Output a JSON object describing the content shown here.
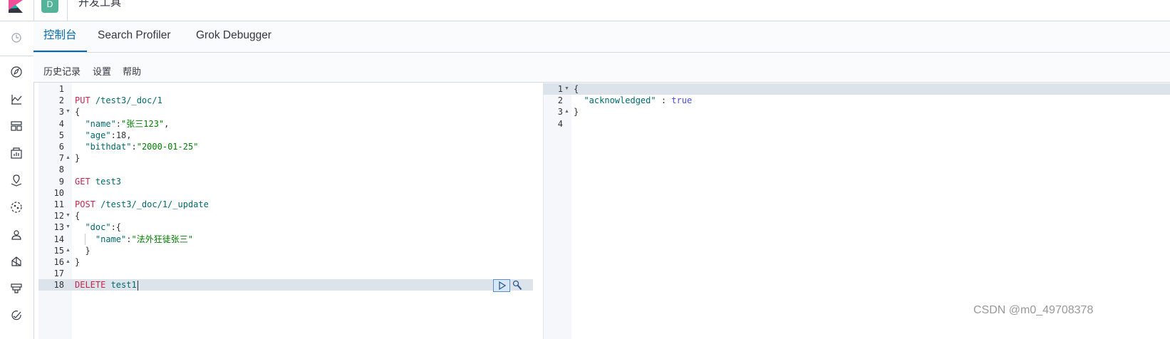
{
  "header": {
    "space_badge": "D",
    "app_title": "开发工具"
  },
  "sidenav": {
    "icons": [
      "clock-icon",
      "compass-icon",
      "visualize-icon",
      "dashboard-icon",
      "canvas-icon",
      "maps-icon",
      "ml-icon",
      "user-icon",
      "graph-icon",
      "layers-icon",
      "heartbeat-icon"
    ]
  },
  "tabs": [
    {
      "label": "控制台",
      "active": true
    },
    {
      "label": "Search Profiler",
      "active": false
    },
    {
      "label": "Grok Debugger",
      "active": false
    }
  ],
  "toolbar": {
    "history": "历史记录",
    "settings": "设置",
    "help": "帮助"
  },
  "editor": {
    "lines": [
      {
        "n": "1",
        "fold": "",
        "parts": []
      },
      {
        "n": "2",
        "fold": "",
        "parts": [
          {
            "c": "method",
            "t": "PUT"
          },
          {
            "c": "url",
            "t": " /test3/_doc/1"
          }
        ]
      },
      {
        "n": "3",
        "fold": "down",
        "parts": [
          {
            "c": "punc",
            "t": "{"
          }
        ]
      },
      {
        "n": "4",
        "fold": "",
        "parts": [
          {
            "c": "key",
            "t": "  \"name\""
          },
          {
            "c": "punc",
            "t": ":"
          },
          {
            "c": "str",
            "t": "\"张三123\""
          },
          {
            "c": "punc",
            "t": ","
          }
        ]
      },
      {
        "n": "5",
        "fold": "",
        "parts": [
          {
            "c": "key",
            "t": "  \"age\""
          },
          {
            "c": "punc",
            "t": ":"
          },
          {
            "c": "num",
            "t": "18"
          },
          {
            "c": "punc",
            "t": ","
          }
        ]
      },
      {
        "n": "6",
        "fold": "",
        "parts": [
          {
            "c": "key",
            "t": "  \"bithdat\""
          },
          {
            "c": "punc",
            "t": ":"
          },
          {
            "c": "str",
            "t": "\"2000-01-25\""
          }
        ]
      },
      {
        "n": "7",
        "fold": "up",
        "parts": [
          {
            "c": "punc",
            "t": "}"
          }
        ]
      },
      {
        "n": "8",
        "fold": "",
        "parts": []
      },
      {
        "n": "9",
        "fold": "",
        "parts": [
          {
            "c": "method",
            "t": "GET"
          },
          {
            "c": "url",
            "t": " test3"
          }
        ]
      },
      {
        "n": "10",
        "fold": "",
        "parts": []
      },
      {
        "n": "11",
        "fold": "",
        "parts": [
          {
            "c": "method",
            "t": "POST"
          },
          {
            "c": "url",
            "t": " /test3/_doc/1/_update"
          }
        ]
      },
      {
        "n": "12",
        "fold": "down",
        "parts": [
          {
            "c": "punc",
            "t": "{"
          }
        ]
      },
      {
        "n": "13",
        "fold": "down",
        "parts": [
          {
            "c": "key",
            "t": "  \"doc\""
          },
          {
            "c": "punc",
            "t": ":{"
          }
        ]
      },
      {
        "n": "14",
        "fold": "",
        "parts": [
          {
            "c": "key",
            "t": "    \"name\""
          },
          {
            "c": "punc",
            "t": ":"
          },
          {
            "c": "str",
            "t": "\"法外狂徒张三\""
          }
        ]
      },
      {
        "n": "15",
        "fold": "up",
        "parts": [
          {
            "c": "punc",
            "t": "  }"
          }
        ]
      },
      {
        "n": "16",
        "fold": "up",
        "parts": [
          {
            "c": "punc",
            "t": "}"
          }
        ]
      },
      {
        "n": "17",
        "fold": "",
        "parts": []
      },
      {
        "n": "18",
        "fold": "",
        "parts": [
          {
            "c": "method",
            "t": "DELETE"
          },
          {
            "c": "url",
            "t": " test1"
          }
        ]
      }
    ],
    "active_line": 18
  },
  "output": {
    "lines": [
      {
        "n": "1",
        "fold": "down",
        "parts": [
          {
            "c": "punc",
            "t": "{"
          }
        ]
      },
      {
        "n": "2",
        "fold": "",
        "parts": [
          {
            "c": "key",
            "t": "  \"acknowledged\""
          },
          {
            "c": "punc",
            "t": " : "
          },
          {
            "c": "bool",
            "t": "true"
          }
        ]
      },
      {
        "n": "3",
        "fold": "up",
        "parts": [
          {
            "c": "punc",
            "t": "}"
          }
        ]
      },
      {
        "n": "4",
        "fold": "",
        "parts": []
      }
    ],
    "active_line": 1
  },
  "watermark": "CSDN @m0_49708378",
  "colors": {
    "accent": "#006bb4",
    "badge": "#54b399",
    "method": "#c7254e",
    "string": "#008000",
    "key": "#006b6b"
  }
}
